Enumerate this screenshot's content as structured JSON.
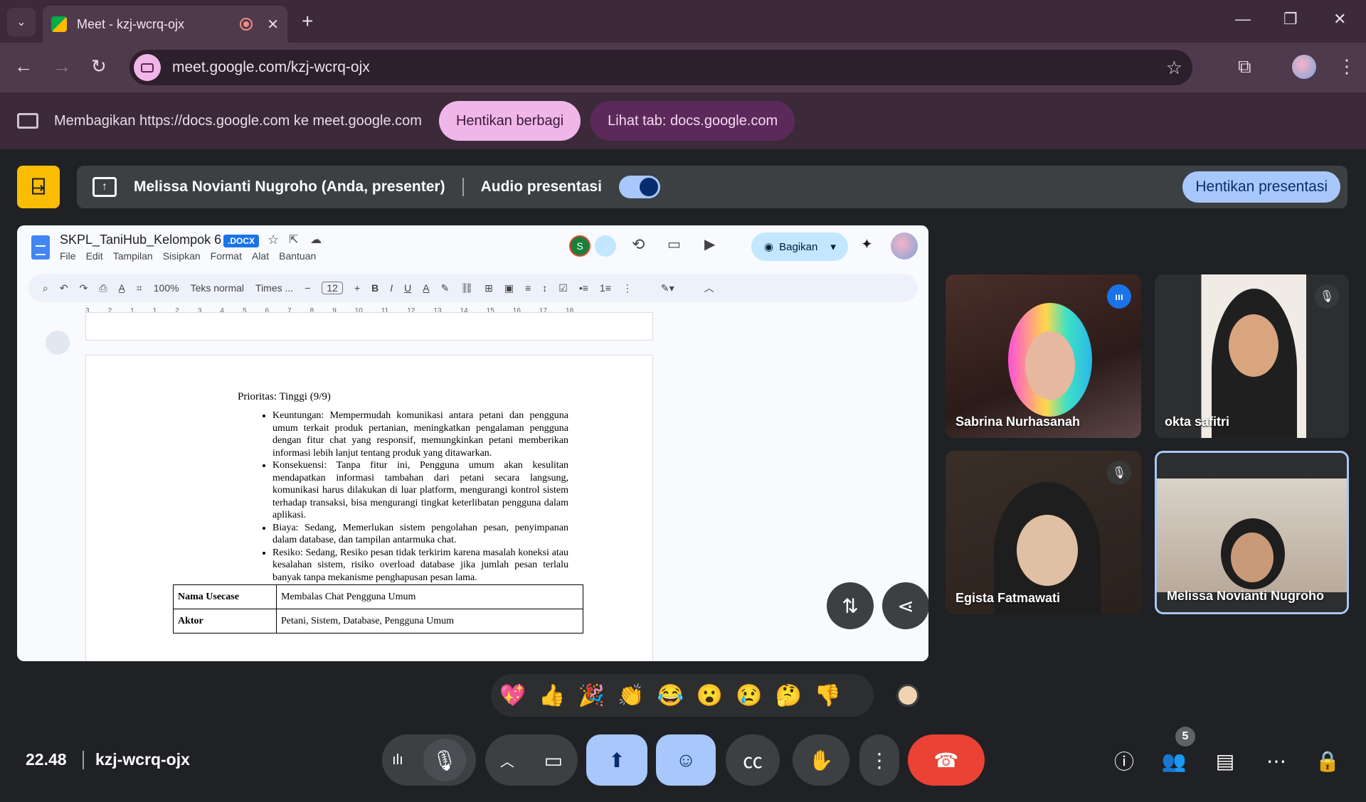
{
  "browser": {
    "tab_title": "Meet - kzj-wcrq-ojx",
    "url": "meet.google.com/kzj-wcrq-ojx"
  },
  "share_bar": {
    "message": "Membagikan https://docs.google.com ke meet.google.com",
    "stop_label": "Hentikan berbagi",
    "view_tab_label": "Lihat tab: docs.google.com"
  },
  "presenter_bar": {
    "presenter_name": "Melissa Novianti Nugroho (Anda, presenter)",
    "audio_label": "Audio presentasi",
    "stop_label": "Hentikan presentasi"
  },
  "doc": {
    "title": "SKPL_TaniHub_Kelompok 6",
    "badge": ".DOCX",
    "menu": [
      "File",
      "Edit",
      "Tampilan",
      "Sisipkan",
      "Format",
      "Alat",
      "Bantuan"
    ],
    "share_label": "Bagikan",
    "collab_initial": "S",
    "toolbar": {
      "zoom": "100%",
      "style": "Teks normal",
      "font": "Times ...",
      "font_size": "12"
    },
    "ruler": [
      "3",
      "2",
      "1",
      "1",
      "2",
      "3",
      "4",
      "5",
      "6",
      "7",
      "8",
      "9",
      "10",
      "11",
      "12",
      "13",
      "14",
      "15",
      "16",
      "17",
      "18"
    ],
    "priority": "Prioritas: Tinggi (9/9)",
    "bullets": [
      "Keuntungan: Mempermudah komunikasi antara petani dan pengguna umum terkait produk pertanian, meningkatkan pengalaman pengguna dengan fitur chat yang responsif, memungkinkan petani memberikan informasi lebih lanjut tentang produk yang ditawarkan.",
      "Konsekuensi: Tanpa fitur ini, Pengguna umum akan kesulitan mendapatkan informasi tambahan dari petani secara langsung, komunikasi harus dilakukan di luar platform, mengurangi kontrol sistem terhadap transaksi, bisa mengurangi tingkat keterlibatan pengguna dalam aplikasi.",
      "Biaya: Sedang, Memerlukan sistem pengolahan pesan, penyimpanan dalam database, dan tampilan antarmuka chat.",
      "Resiko: Sedang, Resiko pesan tidak terkirim karena masalah koneksi atau kesalahan sistem, risiko overload database jika jumlah pesan terlalu banyak tanpa mekanisme penghapusan pesan lama."
    ],
    "table": [
      {
        "key": "Nama Usecase",
        "value": "Membalas Chat Pengguna Umum"
      },
      {
        "key": "Aktor",
        "value": "Petani, Sistem, Database, Pengguna Umum"
      }
    ]
  },
  "participants": [
    {
      "name": "Sabrina Nurhasanah",
      "state": "speaking"
    },
    {
      "name": "okta safitri",
      "state": "muted"
    },
    {
      "name": "Egista Fatmawati",
      "state": "muted"
    },
    {
      "name": "Melissa Novianti Nugroho",
      "state": "self"
    }
  ],
  "reactions": [
    "💖",
    "👍",
    "🎉",
    "👏",
    "😂",
    "😮",
    "😢",
    "🤔",
    "👎"
  ],
  "footer": {
    "time": "22.48",
    "meeting_code": "kzj-wcrq-ojx",
    "participant_count": "5"
  }
}
